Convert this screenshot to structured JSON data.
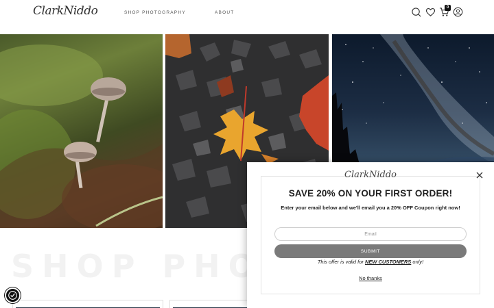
{
  "header": {
    "logo_text": "ClarkNiddo",
    "nav": {
      "shop_label": "SHOP PHOTOGRAPHY",
      "about_label": "ABOUT"
    },
    "cart_count": "0"
  },
  "gallery": {
    "tiles": [
      {
        "subject": "mushrooms-on-moss"
      },
      {
        "subject": "maple-leaves-on-gravel"
      },
      {
        "subject": "milky-way-night-sky"
      }
    ]
  },
  "section": {
    "heading_faded": "SHOP PHOTOGRAPHY"
  },
  "popup": {
    "logo_text": "ClarkNiddo",
    "title": "SAVE 20% ON YOUR FIRST ORDER!",
    "subtitle": "Enter your email below and we'll email you a 20% OFF Coupon right now!",
    "email_placeholder": "Email",
    "submit_label": "SUBMIT",
    "offer_prefix": "This offer is valid for ",
    "offer_highlight": "NEW CUSTOMERS",
    "offer_suffix": " only!",
    "no_thanks_label": "No thanks"
  },
  "colors": {
    "accent": "#7a7a7a",
    "text": "#222222"
  }
}
